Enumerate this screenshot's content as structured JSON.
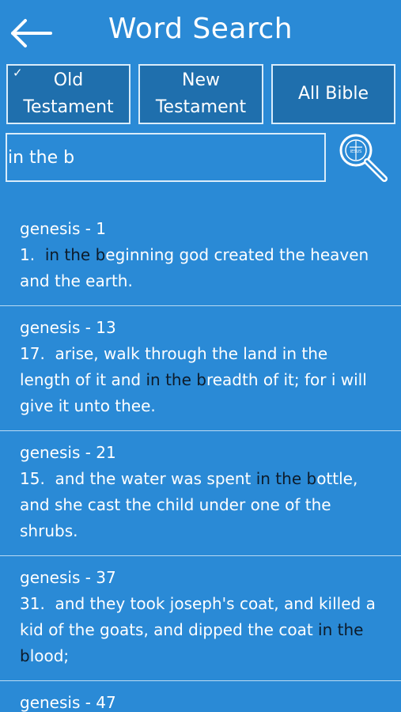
{
  "header": {
    "back_icon": "arrow-left-icon",
    "title": "Word Search"
  },
  "filters": {
    "old": {
      "label": "Old\nTestament",
      "checked": true,
      "check_mark": "✓"
    },
    "new": {
      "label": "New\nTestament",
      "checked": false
    },
    "all": {
      "label": "All Bible",
      "checked": false
    }
  },
  "search": {
    "query": "in the b",
    "button_icon": "magnifier-icon",
    "button_icon_text": "IESUS"
  },
  "results": [
    {
      "ref": "genesis - 1",
      "num": "1.",
      "before": "  ",
      "match": "in the b",
      "after": "eginning god created the heaven and the earth."
    },
    {
      "ref": "genesis - 13",
      "num": "17.",
      "before": "  arise, walk through the land in the length of it and ",
      "match": "in the b",
      "after": "readth of it; for i will give it unto thee."
    },
    {
      "ref": "genesis - 21",
      "num": "15.",
      "before": "  and the water was spent ",
      "match": "in the b",
      "after": "ottle, and she cast the child under one of the shrubs."
    },
    {
      "ref": "genesis - 37",
      "num": "31.",
      "before": "  and they took joseph's coat, and killed a kid of the goats, and dipped the coat ",
      "match": "in the b",
      "after": "lood;"
    },
    {
      "ref": "genesis - 47",
      "num": "",
      "before": "",
      "match": "",
      "after": ""
    }
  ],
  "colors": {
    "background": "#2a8ad6",
    "button_fill": "#1f6fad",
    "border": "#d9ecfa",
    "highlight_text": "#0d1b2a"
  }
}
